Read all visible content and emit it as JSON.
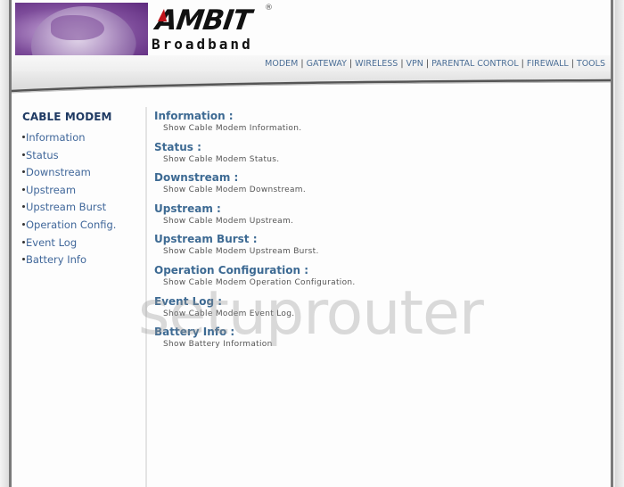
{
  "brand": {
    "name": "AMBIT",
    "registered_mark": "®",
    "tagline": "Broadband"
  },
  "top_nav": {
    "items": [
      {
        "label": "MODEM"
      },
      {
        "label": "GATEWAY"
      },
      {
        "label": "WIRELESS"
      },
      {
        "label": "VPN"
      },
      {
        "label": "PARENTAL CONTROL"
      },
      {
        "label": "FIREWALL"
      },
      {
        "label": "TOOLS"
      }
    ],
    "separator": "|"
  },
  "sidebar": {
    "title": "CABLE MODEM",
    "items": [
      {
        "label": "Information"
      },
      {
        "label": "Status"
      },
      {
        "label": "Downstream"
      },
      {
        "label": "Upstream"
      },
      {
        "label": "Upstream Burst"
      },
      {
        "label": "Operation Config."
      },
      {
        "label": "Event Log"
      },
      {
        "label": "Battery Info"
      }
    ]
  },
  "main": {
    "entries": [
      {
        "title": "Information :",
        "description": "Show Cable Modem Information."
      },
      {
        "title": "Status :",
        "description": "Show Cable Modem Status."
      },
      {
        "title": "Downstream :",
        "description": "Show Cable Modem Downstream."
      },
      {
        "title": "Upstream :",
        "description": "Show Cable Modem Upstream."
      },
      {
        "title": "Upstream Burst :",
        "description": "Show Cable Modem Upstream Burst."
      },
      {
        "title": "Operation Configuration :",
        "description": "Show Cable Modem Operation Configuration."
      },
      {
        "title": "Event Log :",
        "description": "Show Cable Modem Event Log."
      },
      {
        "title": "Battery Info :",
        "description": "Show Battery Information"
      }
    ]
  },
  "watermark": "setuprouter",
  "colors": {
    "nav_link": "#4b6e96",
    "sidebar_title": "#1f3a63",
    "sidebar_link": "#40679a",
    "entry_title": "#3d6a93",
    "logo_accent": "#c0141b"
  }
}
